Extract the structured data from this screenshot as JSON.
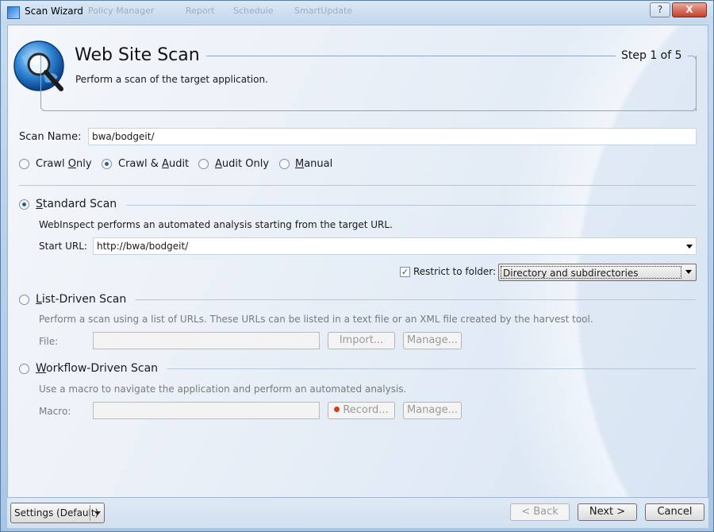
{
  "window": {
    "title": "Scan Wizard",
    "ghost_tabs": [
      "Policy Manager",
      "Report",
      "Schedule",
      "SmartUpdate"
    ],
    "help_button": "?",
    "close_button": "X"
  },
  "header": {
    "title": "Web Site Scan",
    "step": "Step 1 of 5",
    "subtitle": "Perform a scan of the target application."
  },
  "scan_name": {
    "label": "Scan Name:",
    "value": "bwa/bodgeit/"
  },
  "scan_modes": [
    {
      "label": "Crawl Only",
      "selected": false
    },
    {
      "label": "Crawl & Audit",
      "selected": true
    },
    {
      "label": "Audit Only",
      "selected": false
    },
    {
      "label": "Manual",
      "selected": false
    }
  ],
  "standard_scan": {
    "label": "Standard Scan",
    "selected": true,
    "description": "WebInspect performs an automated analysis starting from the target URL.",
    "start_url_label": "Start URL:",
    "start_url_value": "http://bwa/bodgeit/",
    "restrict_label": "Restrict to folder:",
    "restrict_checked": true,
    "restrict_option": "Directory and subdirectories"
  },
  "list_scan": {
    "label": "List-Driven Scan",
    "selected": false,
    "description": "Perform a scan using a list of URLs. These URLs can be listed in a text file or an XML file created by the harvest tool.",
    "file_label": "File:",
    "file_value": "",
    "import_button": "Import...",
    "manage_button": "Manage..."
  },
  "workflow_scan": {
    "label": "Workflow-Driven Scan",
    "selected": false,
    "description": "Use a macro to navigate the application and perform an automated analysis.",
    "macro_label": "Macro:",
    "macro_value": "",
    "record_button": "Record...",
    "manage_button": "Manage..."
  },
  "footer": {
    "settings": "Settings (Default)",
    "back": "< Back",
    "next": "Next >",
    "cancel": "Cancel"
  },
  "colors": {
    "accent": "#2c5f8f",
    "disabled_text": "#9a9a9a"
  }
}
